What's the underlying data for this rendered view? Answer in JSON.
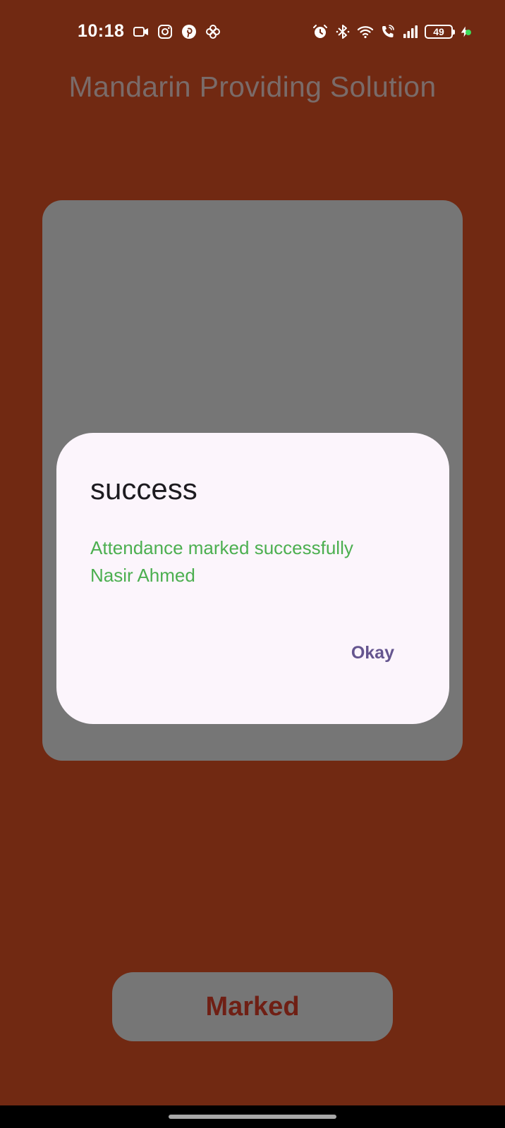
{
  "status_bar": {
    "time": "10:18",
    "left_icons": [
      "video-camera-icon",
      "instagram-icon",
      "pinterest-icon",
      "pinwheel-icon"
    ],
    "right_icons": [
      "alarm-icon",
      "bluetooth-icon",
      "wifi-icon",
      "wifi-calling-icon",
      "signal-icon"
    ],
    "battery_level": "49",
    "charging": true
  },
  "header": {
    "title": "Mandarin Providing Solution"
  },
  "dialog": {
    "title": "success",
    "message_line1": "Attendance marked successfully",
    "message_line2": "Nasir Ahmed",
    "action_label": "Okay"
  },
  "bottom_button": {
    "label": "Marked"
  },
  "colors": {
    "background": "#712912",
    "panel": "#767676",
    "dialog_bg": "#fcf5fc",
    "message": "#4caf50",
    "action": "#65558f",
    "button_text": "#6f1f14"
  }
}
